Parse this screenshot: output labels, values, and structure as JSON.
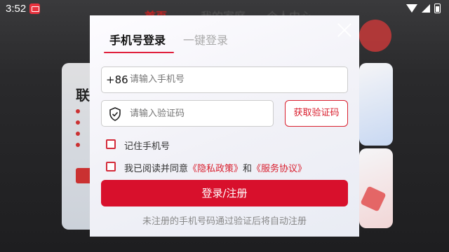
{
  "status_bar": {
    "time": "3:52"
  },
  "background": {
    "tabs": [
      "首页",
      "我的家庭",
      "个人中心"
    ],
    "card_title": "联"
  },
  "login_modal": {
    "tabs": {
      "phone_login": "手机号登录",
      "one_click_login": "一键登录"
    },
    "phone": {
      "prefix": "+86",
      "placeholder": "请输入手机号",
      "value": ""
    },
    "code": {
      "placeholder": "请输入验证码",
      "value": ""
    },
    "get_code_label": "获取验证码",
    "remember_label": "记住手机号",
    "agreement": {
      "prefix": "我已阅读并同意",
      "privacy_link": "《隐私政策》",
      "and": "和",
      "service_link": "《服务协议》"
    },
    "submit_label": "登录/注册",
    "hint": "未注册的手机号码通过验证后将自动注册"
  },
  "colors": {
    "accent": "#d8102c"
  }
}
